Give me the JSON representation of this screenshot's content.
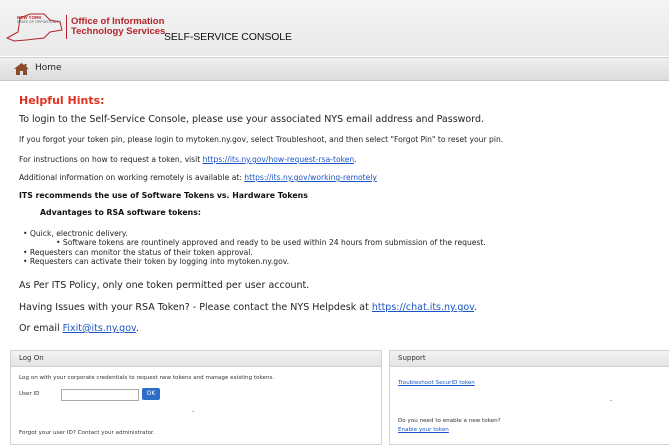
{
  "header": {
    "logo_text_top": "NEW YORK",
    "logo_text_sub": "STATE OF OPPORTUNITY.",
    "org_line1": "Office of Information",
    "org_line2": "Technology Services",
    "console_title": "SELF-SERVICE CONSOLE"
  },
  "nav": {
    "home_label": "Home"
  },
  "hints": {
    "title": "Helpful Hints:",
    "line1": "To login to the Self-Service Console, please use your associated NYS email address and Password.",
    "line2": "If you forgot your token pin, please login to mytoken.ny.gov, select Troubleshoot, and then select \"Forgot Pin\" to reset your pin.",
    "line3_prefix": "For instructions on how to request a token, visit ",
    "line3_link": "https://its.ny.gov/how-request-rsa-token",
    "line3_suffix": ".",
    "line4_prefix": "Additional information on working remotely is available at: ",
    "line4_link": "https://its.ny.gov/working-remotely",
    "recommend": "ITS recommends the use of Software Tokens vs. Hardware Tokens",
    "advantages_title": "Advantages to RSA software tokens:",
    "bullet1": "• Quick, electronic delivery.",
    "bullet1a": "• Software tokens are rountinely approved and ready to be used within 24 hours from submission of the request.",
    "bullet2": "• Requesters can monitor the status of their token approval.",
    "bullet3": "• Requesters can activate their token by logging into mytoken.ny.gov.",
    "policy": "As Per ITS Policy, only one token permitted per user account.",
    "issues_prefix": "Having Issues with your RSA Token? - Please contact the NYS Helpdesk at ",
    "issues_link": "https://chat.its.ny.gov",
    "issues_suffix": ".",
    "email_prefix": "Or email ",
    "email_link": "Fixit@its.ny.gov",
    "email_suffix": "."
  },
  "logon": {
    "title": "Log On",
    "description": "Log on with your corporate credentials to request new tokens and manage existing tokens.",
    "userid_label": "User ID",
    "userid_value": "",
    "ok_label": "OK",
    "forgot": "Forgot your user ID? Contact your administrator."
  },
  "support": {
    "title": "Support",
    "troubleshoot_link": "Troubleshoot SecurID token",
    "enable_question": "Do you need to enable a new token?",
    "enable_link": "Enable your token"
  },
  "colors": {
    "accent_red": "#e0301e",
    "link_blue": "#1a55c5",
    "ok_button": "#2d6fc7"
  }
}
